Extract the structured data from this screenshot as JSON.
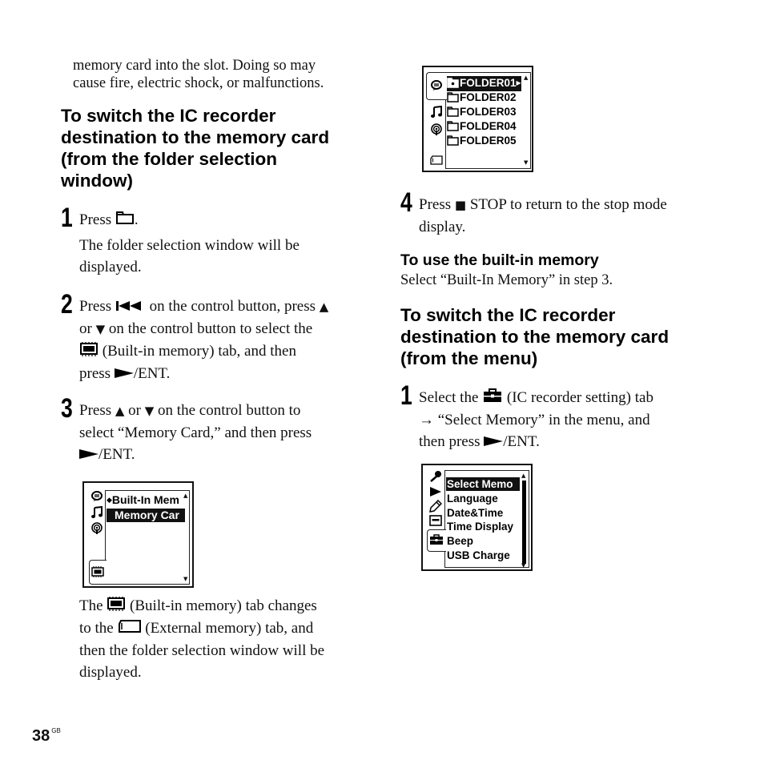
{
  "page": {
    "number": "38",
    "region_code": "GB"
  },
  "left_column": {
    "intro_line1": "memory card into the slot. Doing so may",
    "intro_line2": "cause fire, electric shock, or malfunctions.",
    "heading_lines": [
      "To switch the IC recorder",
      "destination to the memory card",
      "(from the folder selection",
      "window)"
    ],
    "steps": [
      {
        "number": "1",
        "line1_pre": "Press",
        "line1_post": ".",
        "line2": "The folder selection window will be",
        "line3": "displayed."
      },
      {
        "number": "2",
        "line1_pre": "Press",
        "line1_mid": "on the control button, press",
        "line2_pre": "or",
        "line2_post": "on the control button to select the",
        "line3_post": "(Built-in memory) tab, and then",
        "line4_pre": "press",
        "line4_post": "/ENT."
      },
      {
        "number": "3",
        "line1_pre": "Press",
        "line1_mid": "or",
        "line1_post": "on the control button to",
        "line2": "select “Memory Card,” and then press",
        "line3_post": "/ENT."
      }
    ],
    "lcd_memory_select": {
      "items": [
        {
          "label": "Built-In Mem",
          "marker": "◆",
          "selected": false
        },
        {
          "label": "Memory Car",
          "marker": "",
          "selected": true
        }
      ],
      "side_icons": [
        "voice-icon",
        "music-icon",
        "podcast-icon"
      ],
      "tab_icon": "built-in-memory-icon"
    },
    "note": {
      "line1_pre": "The",
      "line1_post": "(Built-in memory) tab changes",
      "line2_pre": "to the",
      "line2_post": "(External memory) tab, and",
      "line3": "then the folder selection window will be",
      "line4": "displayed."
    }
  },
  "right_column": {
    "lcd_folders": {
      "items": [
        {
          "label": "FOLDER01",
          "selected": true,
          "has_arrow": true
        },
        {
          "label": "FOLDER02",
          "selected": false
        },
        {
          "label": "FOLDER03",
          "selected": false
        },
        {
          "label": "FOLDER04",
          "selected": false
        },
        {
          "label": "FOLDER05",
          "selected": false
        }
      ],
      "side_icons": [
        "voice-icon",
        "music-icon",
        "podcast-icon"
      ],
      "tab_icon": "external-memory-icon"
    },
    "step4": {
      "number": "4",
      "line1_pre": "Press",
      "line1_post": "STOP to return to the stop mode",
      "line2": "display."
    },
    "builtin_heading": "To use the built-in memory",
    "builtin_text": "Select “Built-In Memory” in step 3.",
    "heading2_lines": [
      "To switch the IC recorder",
      "destination to the memory card",
      "(from the menu)"
    ],
    "menu_step1": {
      "number": "1",
      "line1_pre": "Select the",
      "line1_post": "(IC recorder setting) tab",
      "line2_arrow": "→",
      "line2_post": "“Select Memory” in the menu, and",
      "line3_pre": "then press",
      "line3_post": "/ENT."
    },
    "lcd_menu": {
      "items": [
        {
          "label": "Select Memo",
          "selected": true
        },
        {
          "label": "Language",
          "selected": false
        },
        {
          "label": "Date&Time",
          "selected": false
        },
        {
          "label": "Time Display",
          "selected": false
        },
        {
          "label": "Beep",
          "selected": false
        },
        {
          "label": "USB Charge",
          "selected": false
        }
      ],
      "side_icons": [
        "microphone-icon",
        "play-icon",
        "edit-icon",
        "display-icon",
        "toolbox-icon"
      ]
    }
  },
  "glyphs": {
    "up": "▲",
    "down": "▼",
    "play": "►",
    "stop": "■",
    "prev": "◀◀",
    "arrow_right": "→"
  }
}
